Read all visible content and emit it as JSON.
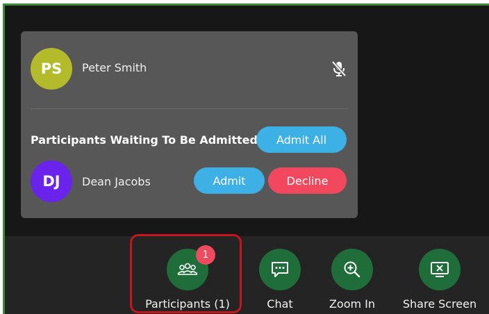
{
  "colors": {
    "frame_border": "#3d8a3a",
    "panel_bg": "#575757",
    "toolbar_button": "#1f6e3a",
    "accent_blue": "#3db0e6",
    "accent_red": "#f2485e",
    "highlight": "#c8141c"
  },
  "in_meeting": {
    "participant": {
      "initials": "PS",
      "name": "Peter Smith",
      "avatar_color": "#b3bb2b",
      "mic_icon": "mic-muted-icon"
    }
  },
  "waiting": {
    "title": "Participants Waiting To Be Admitted",
    "admit_all_label": "Admit All",
    "participant": {
      "initials": "DJ",
      "name": "Dean Jacobs",
      "avatar_color": "#6a23ea"
    },
    "admit_label": "Admit",
    "decline_label": "Decline"
  },
  "toolbar": {
    "participants": {
      "label": "Participants (1)",
      "badge": "1",
      "icon": "participants-icon"
    },
    "chat": {
      "label": "Chat",
      "icon": "chat-icon"
    },
    "zoom_in": {
      "label": "Zoom In",
      "icon": "zoom-in-icon"
    },
    "share_screen": {
      "label": "Share Screen",
      "icon": "share-screen-icon"
    }
  }
}
